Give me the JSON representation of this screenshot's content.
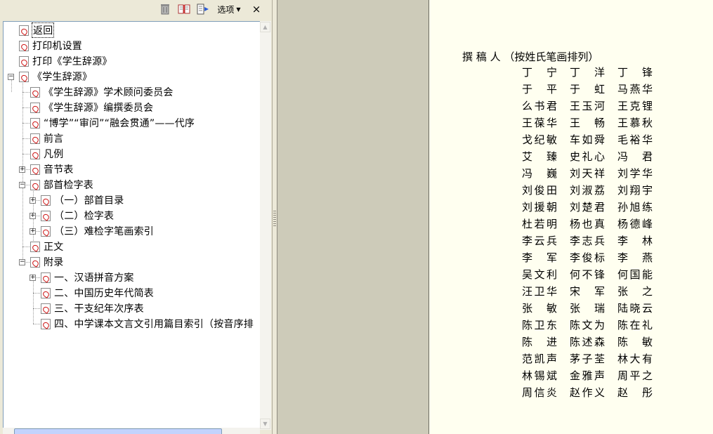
{
  "toolbar": {
    "delete_icon": "trash-icon",
    "bookmark_icon": "book-icon",
    "expand_icon": "book-arrow-icon",
    "options_label": "选项",
    "close_label": "×"
  },
  "bookmarks": [
    {
      "label": "返回",
      "level": 0,
      "toggle": "",
      "selected": true
    },
    {
      "label": "打印机设置",
      "level": 0,
      "toggle": ""
    },
    {
      "label": "打印《学生辞源》",
      "level": 0,
      "toggle": ""
    },
    {
      "label": "《学生辞源》",
      "level": 0,
      "toggle": "−"
    },
    {
      "label": "《学生辞源》学术顾问委员会",
      "level": 1,
      "toggle": ""
    },
    {
      "label": "《学生辞源》编撰委员会",
      "level": 1,
      "toggle": ""
    },
    {
      "label": "“博学”“审问”“融会贯通”——代序",
      "level": 1,
      "toggle": ""
    },
    {
      "label": "前言",
      "level": 1,
      "toggle": ""
    },
    {
      "label": "凡例",
      "level": 1,
      "toggle": ""
    },
    {
      "label": "音节表",
      "level": 1,
      "toggle": "+"
    },
    {
      "label": "部首检字表",
      "level": 1,
      "toggle": "−"
    },
    {
      "label": "（一）部首目录",
      "level": 2,
      "toggle": "+"
    },
    {
      "label": "（二）检字表",
      "level": 2,
      "toggle": "+"
    },
    {
      "label": "（三）难检字笔画索引",
      "level": 2,
      "toggle": "+"
    },
    {
      "label": "正文",
      "level": 1,
      "toggle": ""
    },
    {
      "label": "附录",
      "level": 1,
      "toggle": "−"
    },
    {
      "label": "一、汉语拼音方案",
      "level": 2,
      "toggle": "+"
    },
    {
      "label": "二、中国历史年代简表",
      "level": 2,
      "toggle": ""
    },
    {
      "label": "三、干支纪年次序表",
      "level": 2,
      "toggle": ""
    },
    {
      "label": "四、中学课本文言文引用篇目索引（按音序排",
      "level": 2,
      "toggle": ""
    }
  ],
  "document": {
    "heading": "撰稿人（按姓氏笔画排列）",
    "heading_parts": [
      "撰",
      "稿",
      "人",
      "（按姓氏笔画排列）"
    ],
    "names": [
      [
        "丁宁",
        "丁洋",
        "丁锋"
      ],
      [
        "于平",
        "于虹",
        "马燕华"
      ],
      [
        "么书君",
        "王玉河",
        "王克锂"
      ],
      [
        "王葆华",
        "王畅",
        "王慕秋"
      ],
      [
        "戈纪敏",
        "车如舜",
        "毛裕华"
      ],
      [
        "艾臻",
        "史礼心",
        "冯君"
      ],
      [
        "冯巍",
        "刘天祥",
        "刘学华"
      ],
      [
        "刘俊田",
        "刘淑荔",
        "刘翔宇"
      ],
      [
        "刘援朝",
        "刘楚君",
        "孙旭练"
      ],
      [
        "杜若明",
        "杨也真",
        "杨德峰"
      ],
      [
        "李云兵",
        "李志兵",
        "李林"
      ],
      [
        "李军",
        "李俊标",
        "李燕"
      ],
      [
        "吴文利",
        "何不锋",
        "何国能"
      ],
      [
        "汪卫华",
        "宋军",
        "张之"
      ],
      [
        "张敏",
        "张瑞",
        "陆晓云"
      ],
      [
        "陈卫东",
        "陈文为",
        "陈在礼"
      ],
      [
        "陈进",
        "陈述森",
        "陈敏"
      ],
      [
        "范凯声",
        "茅子荃",
        "林大有"
      ],
      [
        "林锡斌",
        "金雅声",
        "周平之"
      ],
      [
        "周信炎",
        "赵作义",
        "赵彤"
      ]
    ]
  }
}
